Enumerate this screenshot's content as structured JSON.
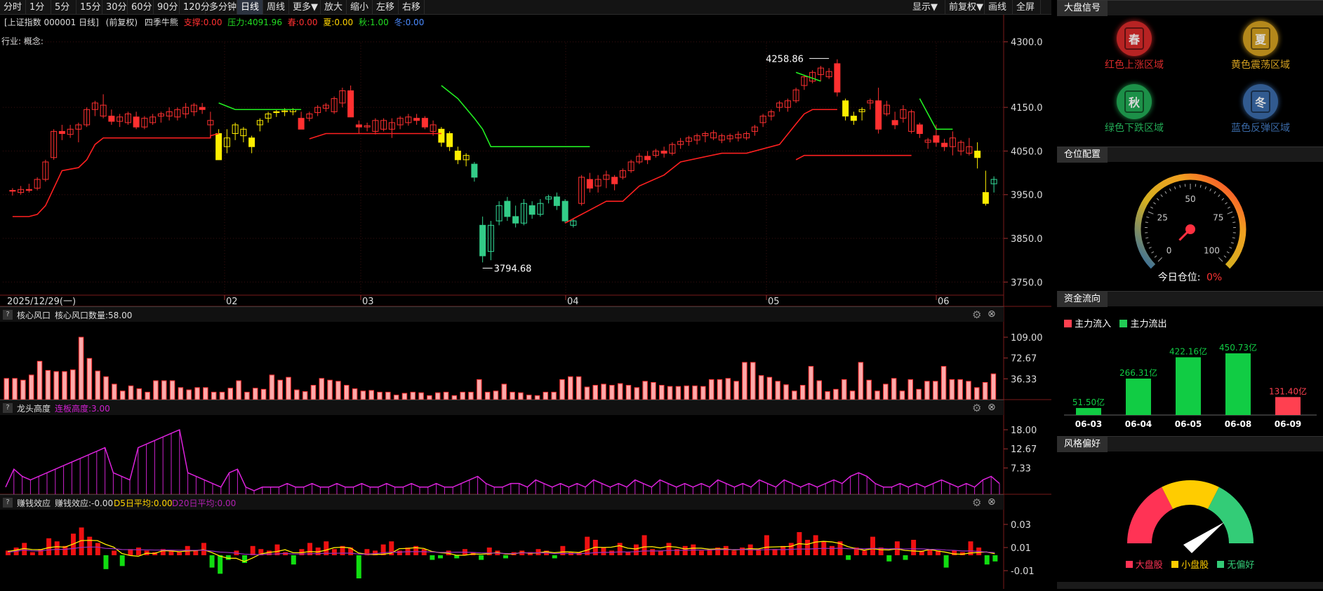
{
  "toolbar": {
    "left": [
      "分时",
      "1分",
      "5分",
      "15分",
      "30分",
      "60分",
      "90分",
      "120分",
      "多分钟",
      "日线",
      "周线",
      "更多▼",
      "放大",
      "缩小",
      "左移",
      "右移"
    ],
    "right": [
      "显示▼",
      "前复权▼",
      "画线",
      "全屏"
    ],
    "active": "日线"
  },
  "info_line": {
    "index": "[上证指数 000001 日线]",
    "adjust": "(前复权)",
    "indicator": "四季牛熊",
    "support": "支撑:0.00",
    "pressure": "压力:4091.96",
    "spring": "春:0.00",
    "summer": "夏:0.00",
    "autumn": "秋:1.00",
    "winter": "冬:0.00"
  },
  "industry_line": "行业: 概念:",
  "price_axis": [
    "4300.0",
    "4150.0",
    "4050.0",
    "3950.0",
    "3850.0",
    "3750.0"
  ],
  "annotations": {
    "high": "4258.86",
    "low": "3794.68"
  },
  "date_axis": {
    "start": "2025/12/29(一)",
    "months": [
      "02",
      "03",
      "04",
      "05",
      "06"
    ]
  },
  "panels": [
    {
      "title": "核心风口",
      "value_label": "核心风口数量:58.00",
      "value_extra": "",
      "axis": [
        "109.00",
        "72.67",
        "36.33"
      ]
    },
    {
      "title": "龙头高度",
      "value_label": "",
      "value_extra": "连板高度:3.00",
      "axis": [
        "18.00",
        "12.67",
        "7.33"
      ]
    },
    {
      "title": "赚钱效应",
      "value_label": "赚钱效应:-0.00",
      "value_extra": "D5日平均:0.00",
      "value_extra2": "D20日平均:0.00",
      "axis": [
        "0.03",
        "0.01",
        "-0.01"
      ]
    }
  ],
  "sidebar": {
    "market_signal": {
      "tab": "大盘信号",
      "items": [
        {
          "char": "春",
          "label": "红色上涨区域",
          "color": "#d82a2a"
        },
        {
          "char": "夏",
          "label": "黄色震荡区域",
          "color": "#d4a020"
        },
        {
          "char": "秋",
          "label": "绿色下跌区域",
          "color": "#22aa55"
        },
        {
          "char": "冬",
          "label": "蓝色反弹区域",
          "color": "#3a6aa8"
        }
      ]
    },
    "position": {
      "tab": "仓位配置",
      "ticks": [
        "0",
        "25",
        "50",
        "75",
        "100"
      ],
      "today_label": "今日仓位:",
      "today_value": "0%",
      "gauge_value": 0
    },
    "fund_flow": {
      "tab": "资金流向",
      "legend_in": "主力流入",
      "legend_out": "主力流出",
      "bars": [
        {
          "date": "06-03",
          "value": "51.50亿",
          "amount": 51.5,
          "dir": "in"
        },
        {
          "date": "06-04",
          "value": "266.31亿",
          "amount": 266.31,
          "dir": "in"
        },
        {
          "date": "06-05",
          "value": "422.16亿",
          "amount": 422.16,
          "dir": "in"
        },
        {
          "date": "06-08",
          "value": "450.73亿",
          "amount": 450.73,
          "dir": "in"
        },
        {
          "date": "06-09",
          "value": "131.40亿",
          "amount": 131.4,
          "dir": "out"
        }
      ]
    },
    "style": {
      "tab": "风格偏好",
      "legend": [
        "大盘股",
        "小盘股",
        "无偏好"
      ]
    }
  },
  "chart_data": {
    "type": "candlestick",
    "ylim": [
      3720,
      4330
    ],
    "candles": [
      [
        3960,
        3965,
        3948,
        3958
      ],
      [
        3955,
        3970,
        3950,
        3962
      ],
      [
        3962,
        3975,
        3955,
        3960
      ],
      [
        3965,
        3990,
        3960,
        3985
      ],
      [
        3985,
        4030,
        3980,
        4025
      ],
      [
        4035,
        4100,
        4030,
        4095
      ],
      [
        4095,
        4110,
        4075,
        4090
      ],
      [
        4088,
        4110,
        4080,
        4100
      ],
      [
        4100,
        4115,
        4070,
        4110
      ],
      [
        4110,
        4150,
        4105,
        4145
      ],
      [
        4145,
        4165,
        4130,
        4160
      ],
      [
        4130,
        4180,
        4125,
        4155
      ],
      [
        4130,
        4145,
        4110,
        4118
      ],
      [
        4118,
        4135,
        4105,
        4128
      ],
      [
        4115,
        4140,
        4110,
        4135
      ],
      [
        4128,
        4140,
        4100,
        4105
      ],
      [
        4105,
        4130,
        4100,
        4125
      ],
      [
        4115,
        4135,
        4110,
        4128
      ],
      [
        4130,
        4140,
        4115,
        4135
      ],
      [
        4130,
        4150,
        4120,
        4140
      ],
      [
        4128,
        4150,
        4120,
        4145
      ],
      [
        4135,
        4160,
        4125,
        4150
      ],
      [
        4140,
        4160,
        4130,
        4155
      ],
      [
        4150,
        4160,
        4135,
        4145
      ],
      [
        4110,
        4140,
        4085,
        4120
      ],
      [
        4090,
        4100,
        4060,
        4030
      ],
      [
        4060,
        4100,
        4045,
        4080
      ],
      [
        4090,
        4115,
        4075,
        4110
      ],
      [
        4085,
        4105,
        4070,
        4100
      ],
      [
        4080,
        4085,
        4045,
        4060
      ],
      [
        4110,
        4125,
        4095,
        4120
      ],
      [
        4125,
        4140,
        4115,
        4135
      ],
      [
        4140,
        4145,
        4128,
        4138
      ],
      [
        4140,
        4148,
        4130,
        4142
      ],
      [
        4140,
        4148,
        4132,
        4145
      ],
      [
        4125,
        4140,
        4115,
        4100
      ],
      [
        4125,
        4140,
        4118,
        4135
      ],
      [
        4138,
        4155,
        4130,
        4150
      ],
      [
        4148,
        4160,
        4140,
        4155
      ],
      [
        4140,
        4175,
        4135,
        4170
      ],
      [
        4160,
        4195,
        4150,
        4188
      ],
      [
        4188,
        4200,
        4130,
        4128
      ],
      [
        4110,
        4120,
        4090,
        4105
      ],
      [
        4105,
        4115,
        4095,
        4108
      ],
      [
        4095,
        4125,
        4088,
        4120
      ],
      [
        4100,
        4125,
        4095,
        4120
      ],
      [
        4100,
        4125,
        4080,
        4115
      ],
      [
        4110,
        4130,
        4100,
        4125
      ],
      [
        4115,
        4135,
        4108,
        4128
      ],
      [
        4125,
        4135,
        4110,
        4120
      ],
      [
        4125,
        4130,
        4100,
        4105
      ],
      [
        4095,
        4120,
        4085,
        4110
      ],
      [
        4100,
        4105,
        4060,
        4070
      ],
      [
        4090,
        4095,
        4050,
        4060
      ],
      [
        4050,
        4060,
        4020,
        4030
      ],
      [
        4030,
        4045,
        4015,
        4040
      ],
      [
        4020,
        4025,
        3980,
        3990
      ],
      [
        3880,
        3900,
        3795,
        3810
      ],
      [
        3820,
        3890,
        3800,
        3880
      ],
      [
        3890,
        3935,
        3880,
        3925
      ],
      [
        3935,
        3945,
        3890,
        3900
      ],
      [
        3900,
        3925,
        3875,
        3885
      ],
      [
        3885,
        3940,
        3880,
        3930
      ],
      [
        3925,
        3935,
        3895,
        3905
      ],
      [
        3905,
        3940,
        3900,
        3930
      ],
      [
        3940,
        3950,
        3930,
        3945
      ],
      [
        3945,
        3955,
        3915,
        3925
      ],
      [
        3935,
        3940,
        3885,
        3890
      ],
      [
        3880,
        3895,
        3875,
        3890
      ],
      [
        3930,
        3995,
        3925,
        3990
      ],
      [
        3985,
        4000,
        3955,
        3965
      ],
      [
        3970,
        3995,
        3955,
        3985
      ],
      [
        3985,
        4005,
        3965,
        3995
      ],
      [
        3990,
        3995,
        3960,
        3975
      ],
      [
        3990,
        4010,
        3985,
        4005
      ],
      [
        4005,
        4030,
        4000,
        4025
      ],
      [
        4025,
        4045,
        4020,
        4038
      ],
      [
        4038,
        4050,
        4020,
        4030
      ],
      [
        4040,
        4055,
        4035,
        4050
      ],
      [
        4050,
        4060,
        4035,
        4045
      ],
      [
        4045,
        4070,
        4040,
        4065
      ],
      [
        4065,
        4080,
        4055,
        4072
      ],
      [
        4072,
        4085,
        4062,
        4080
      ],
      [
        4075,
        4090,
        4065,
        4085
      ],
      [
        4085,
        4095,
        4070,
        4090
      ],
      [
        4080,
        4098,
        4075,
        4092
      ],
      [
        4075,
        4090,
        4068,
        4085
      ],
      [
        4078,
        4090,
        4070,
        4085
      ],
      [
        4080,
        4095,
        4072,
        4088
      ],
      [
        4080,
        4095,
        4075,
        4090
      ],
      [
        4095,
        4110,
        4085,
        4105
      ],
      [
        4115,
        4135,
        4105,
        4130
      ],
      [
        4130,
        4145,
        4120,
        4140
      ],
      [
        4150,
        4165,
        4140,
        4160
      ],
      [
        4150,
        4170,
        4140,
        4165
      ],
      [
        4165,
        4195,
        4160,
        4190
      ],
      [
        4200,
        4225,
        4190,
        4220
      ],
      [
        4210,
        4235,
        4205,
        4230
      ],
      [
        4225,
        4245,
        4210,
        4240
      ],
      [
        4220,
        4240,
        4215,
        4232
      ],
      [
        4250,
        4260,
        4175,
        4185
      ],
      [
        4165,
        4170,
        4120,
        4130
      ],
      [
        4130,
        4140,
        4110,
        4120
      ],
      [
        4140,
        4150,
        4120,
        4145
      ],
      [
        4160,
        4170,
        4145,
        4165
      ],
      [
        4165,
        4195,
        4090,
        4100
      ],
      [
        4135,
        4165,
        4130,
        4155
      ],
      [
        4120,
        4140,
        4100,
        4110
      ],
      [
        4125,
        4155,
        4115,
        4145
      ],
      [
        4095,
        4145,
        4090,
        4140
      ],
      [
        4110,
        4115,
        4080,
        4090
      ],
      [
        4070,
        4080,
        4055,
        4075
      ],
      [
        4085,
        4110,
        4060,
        4070
      ],
      [
        4068,
        4078,
        4050,
        4060
      ],
      [
        4060,
        4095,
        4040,
        4080
      ],
      [
        4050,
        4075,
        4040,
        4070
      ],
      [
        4045,
        4080,
        4040,
        4060
      ],
      [
        4050,
        4070,
        4010,
        4035
      ],
      [
        3955,
        4005,
        3925,
        3930
      ],
      [
        3975,
        3992,
        3955,
        3985
      ]
    ],
    "support_line": [
      [
        0,
        3900
      ],
      [
        2,
        3900
      ],
      [
        3,
        3905
      ],
      [
        4,
        3925
      ],
      [
        5,
        3965
      ],
      [
        6,
        4005
      ],
      [
        8,
        4012
      ],
      [
        9,
        4030
      ],
      [
        10,
        4065
      ],
      [
        11,
        4080
      ],
      [
        24,
        4080
      ],
      [
        24,
        4085
      ],
      [
        25,
        4090
      ]
    ],
    "pressure_line": [
      [
        25,
        4160
      ],
      [
        27,
        4145
      ],
      [
        35,
        4145
      ]
    ],
    "support_line2": [
      [
        36,
        4078
      ],
      [
        38,
        4090
      ],
      [
        44,
        4090
      ],
      [
        52,
        4090
      ]
    ],
    "pressure_line2": [
      [
        52,
        4200
      ],
      [
        54,
        4170
      ],
      [
        56,
        4125
      ],
      [
        57,
        4100
      ],
      [
        58,
        4060
      ],
      [
        70,
        4060
      ]
    ],
    "support_line3": [
      [
        67,
        3885
      ],
      [
        69,
        3905
      ],
      [
        70,
        3915
      ],
      [
        72,
        3935
      ],
      [
        74,
        3935
      ],
      [
        76,
        3970
      ],
      [
        79,
        3995
      ],
      [
        81,
        4025
      ],
      [
        86,
        4045
      ],
      [
        89,
        4045
      ],
      [
        93,
        4065
      ],
      [
        95,
        4112
      ],
      [
        96,
        4135
      ],
      [
        97,
        4145
      ],
      [
        100,
        4145
      ]
    ],
    "pressure_line3": [
      [
        95,
        4230
      ],
      [
        98,
        4210
      ]
    ],
    "pressure_line4": [
      [
        110,
        4170
      ],
      [
        112,
        4100
      ],
      [
        114,
        4100
      ]
    ],
    "support_line4": [
      [
        95,
        4030
      ],
      [
        96,
        4040
      ],
      [
        105,
        4040
      ],
      [
        109,
        4040
      ]
    ],
    "core_values": [
      37,
      37,
      34,
      43,
      67,
      51,
      49,
      49,
      52,
      109,
      72,
      50,
      40,
      27,
      15,
      24,
      19,
      13,
      33,
      33,
      33,
      21,
      17,
      21,
      21,
      13,
      13,
      20,
      33,
      13,
      20,
      18,
      43,
      34,
      39,
      17,
      14,
      25,
      37,
      34,
      32,
      25,
      19,
      15,
      16,
      13,
      13,
      8,
      11,
      13,
      12,
      7,
      12,
      13,
      7,
      13,
      13,
      35,
      13,
      15,
      27,
      13,
      12,
      8,
      7,
      13,
      13,
      35,
      40,
      40,
      22,
      25,
      27,
      25,
      28,
      25,
      21,
      32,
      30,
      25,
      23,
      23,
      24,
      24,
      23,
      35,
      35,
      37,
      32,
      65,
      65,
      42,
      39,
      32,
      26,
      15,
      25,
      58,
      33,
      14,
      18,
      35,
      15,
      65,
      34,
      15,
      27,
      37,
      15,
      35,
      18,
      32,
      32,
      58,
      35,
      35,
      32,
      21,
      30,
      45
    ]
  }
}
